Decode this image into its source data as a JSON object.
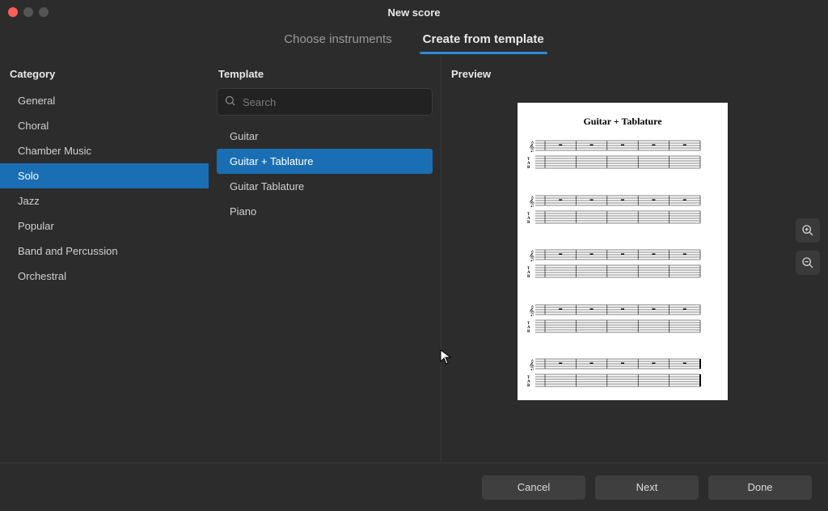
{
  "window": {
    "title": "New score"
  },
  "tabs": {
    "choose": "Choose instruments",
    "template": "Create from template",
    "active": "template"
  },
  "headings": {
    "category": "Category",
    "template": "Template",
    "preview": "Preview"
  },
  "search": {
    "placeholder": "Search",
    "value": ""
  },
  "category": {
    "items": [
      {
        "label": "General"
      },
      {
        "label": "Choral"
      },
      {
        "label": "Chamber Music"
      },
      {
        "label": "Solo",
        "selected": true
      },
      {
        "label": "Jazz"
      },
      {
        "label": "Popular"
      },
      {
        "label": "Band and Percussion"
      },
      {
        "label": "Orchestral"
      }
    ]
  },
  "template": {
    "items": [
      {
        "label": "Guitar"
      },
      {
        "label": "Guitar + Tablature",
        "selected": true
      },
      {
        "label": "Guitar Tablature"
      },
      {
        "label": "Piano"
      }
    ]
  },
  "preview": {
    "title": "Guitar + Tablature",
    "systems": 5,
    "measures_per_system": 5
  },
  "footer": {
    "cancel": "Cancel",
    "next": "Next",
    "done": "Done"
  },
  "colors": {
    "accent": "#1a6fb4"
  }
}
